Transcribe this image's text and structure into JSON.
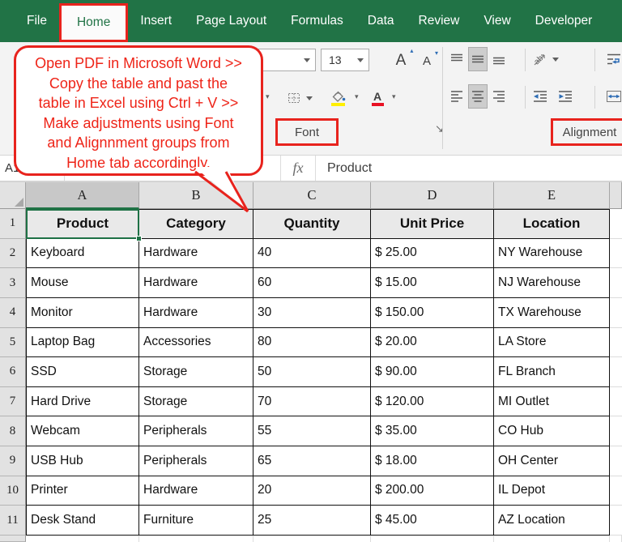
{
  "tabbar": {
    "tabs": [
      {
        "label": "File"
      },
      {
        "label": "Home",
        "active": true
      },
      {
        "label": "Insert"
      },
      {
        "label": "Page Layout"
      },
      {
        "label": "Formulas"
      },
      {
        "label": "Data"
      },
      {
        "label": "Review"
      },
      {
        "label": "View"
      },
      {
        "label": "Developer"
      }
    ]
  },
  "callout": {
    "text": "Open PDF in Microsoft Word >>\nCopy the table and past the\ntable in Excel using Ctrl + V >>\nMake adjustments using Font\nand Alignnment groups from\nHome tab accordingly."
  },
  "ribbon": {
    "font_group": {
      "label": "Font",
      "font_size": "13",
      "grow_font_letter": "A",
      "shrink_font_letter": "A",
      "font_color_letter": "A"
    },
    "alignment_group": {
      "label": "Alignment"
    }
  },
  "icons": {
    "dropdown": "▾",
    "caret_up": "▴",
    "caret_down": "▾",
    "dialog_launcher": "↘"
  },
  "colors": {
    "accent_green": "#217346",
    "annotation_red": "#e8231d",
    "fill_color_swatch": "#ffef00",
    "font_color_swatch": "#e81123",
    "selection_green": "#1e7145"
  },
  "formula_bar": {
    "name_box": "A1",
    "fx_label": "fx",
    "value": "Product"
  },
  "sheet": {
    "column_headers": [
      "A",
      "B",
      "C",
      "D",
      "E"
    ],
    "row_numbers": [
      "1",
      "2",
      "3",
      "4",
      "5",
      "6",
      "7",
      "8",
      "9",
      "10",
      "11"
    ],
    "selected_cell": "A1"
  },
  "table": {
    "headers": [
      "Product",
      "Category",
      "Quantity",
      "Unit Price",
      "Location"
    ],
    "rows": [
      [
        "Keyboard",
        "Hardware",
        "40",
        "$ 25.00",
        "NY Warehouse"
      ],
      [
        "Mouse",
        "Hardware",
        "60",
        "$ 15.00",
        "NJ Warehouse"
      ],
      [
        "Monitor",
        "Hardware",
        "30",
        "$ 150.00",
        "TX Warehouse"
      ],
      [
        "Laptop Bag",
        "Accessories",
        "80",
        "$ 20.00",
        "LA Store"
      ],
      [
        "SSD",
        "Storage",
        "50",
        "$ 90.00",
        "FL Branch"
      ],
      [
        "Hard Drive",
        "Storage",
        "70",
        "$ 120.00",
        "MI Outlet"
      ],
      [
        "Webcam",
        "Peripherals",
        "55",
        "$ 35.00",
        "CO Hub"
      ],
      [
        "USB Hub",
        "Peripherals",
        "65",
        "$ 18.00",
        "OH Center"
      ],
      [
        "Printer",
        "Hardware",
        "20",
        "$ 200.00",
        "IL Depot"
      ],
      [
        "Desk Stand",
        "Furniture",
        "25",
        "$ 45.00",
        "AZ Location"
      ]
    ]
  }
}
